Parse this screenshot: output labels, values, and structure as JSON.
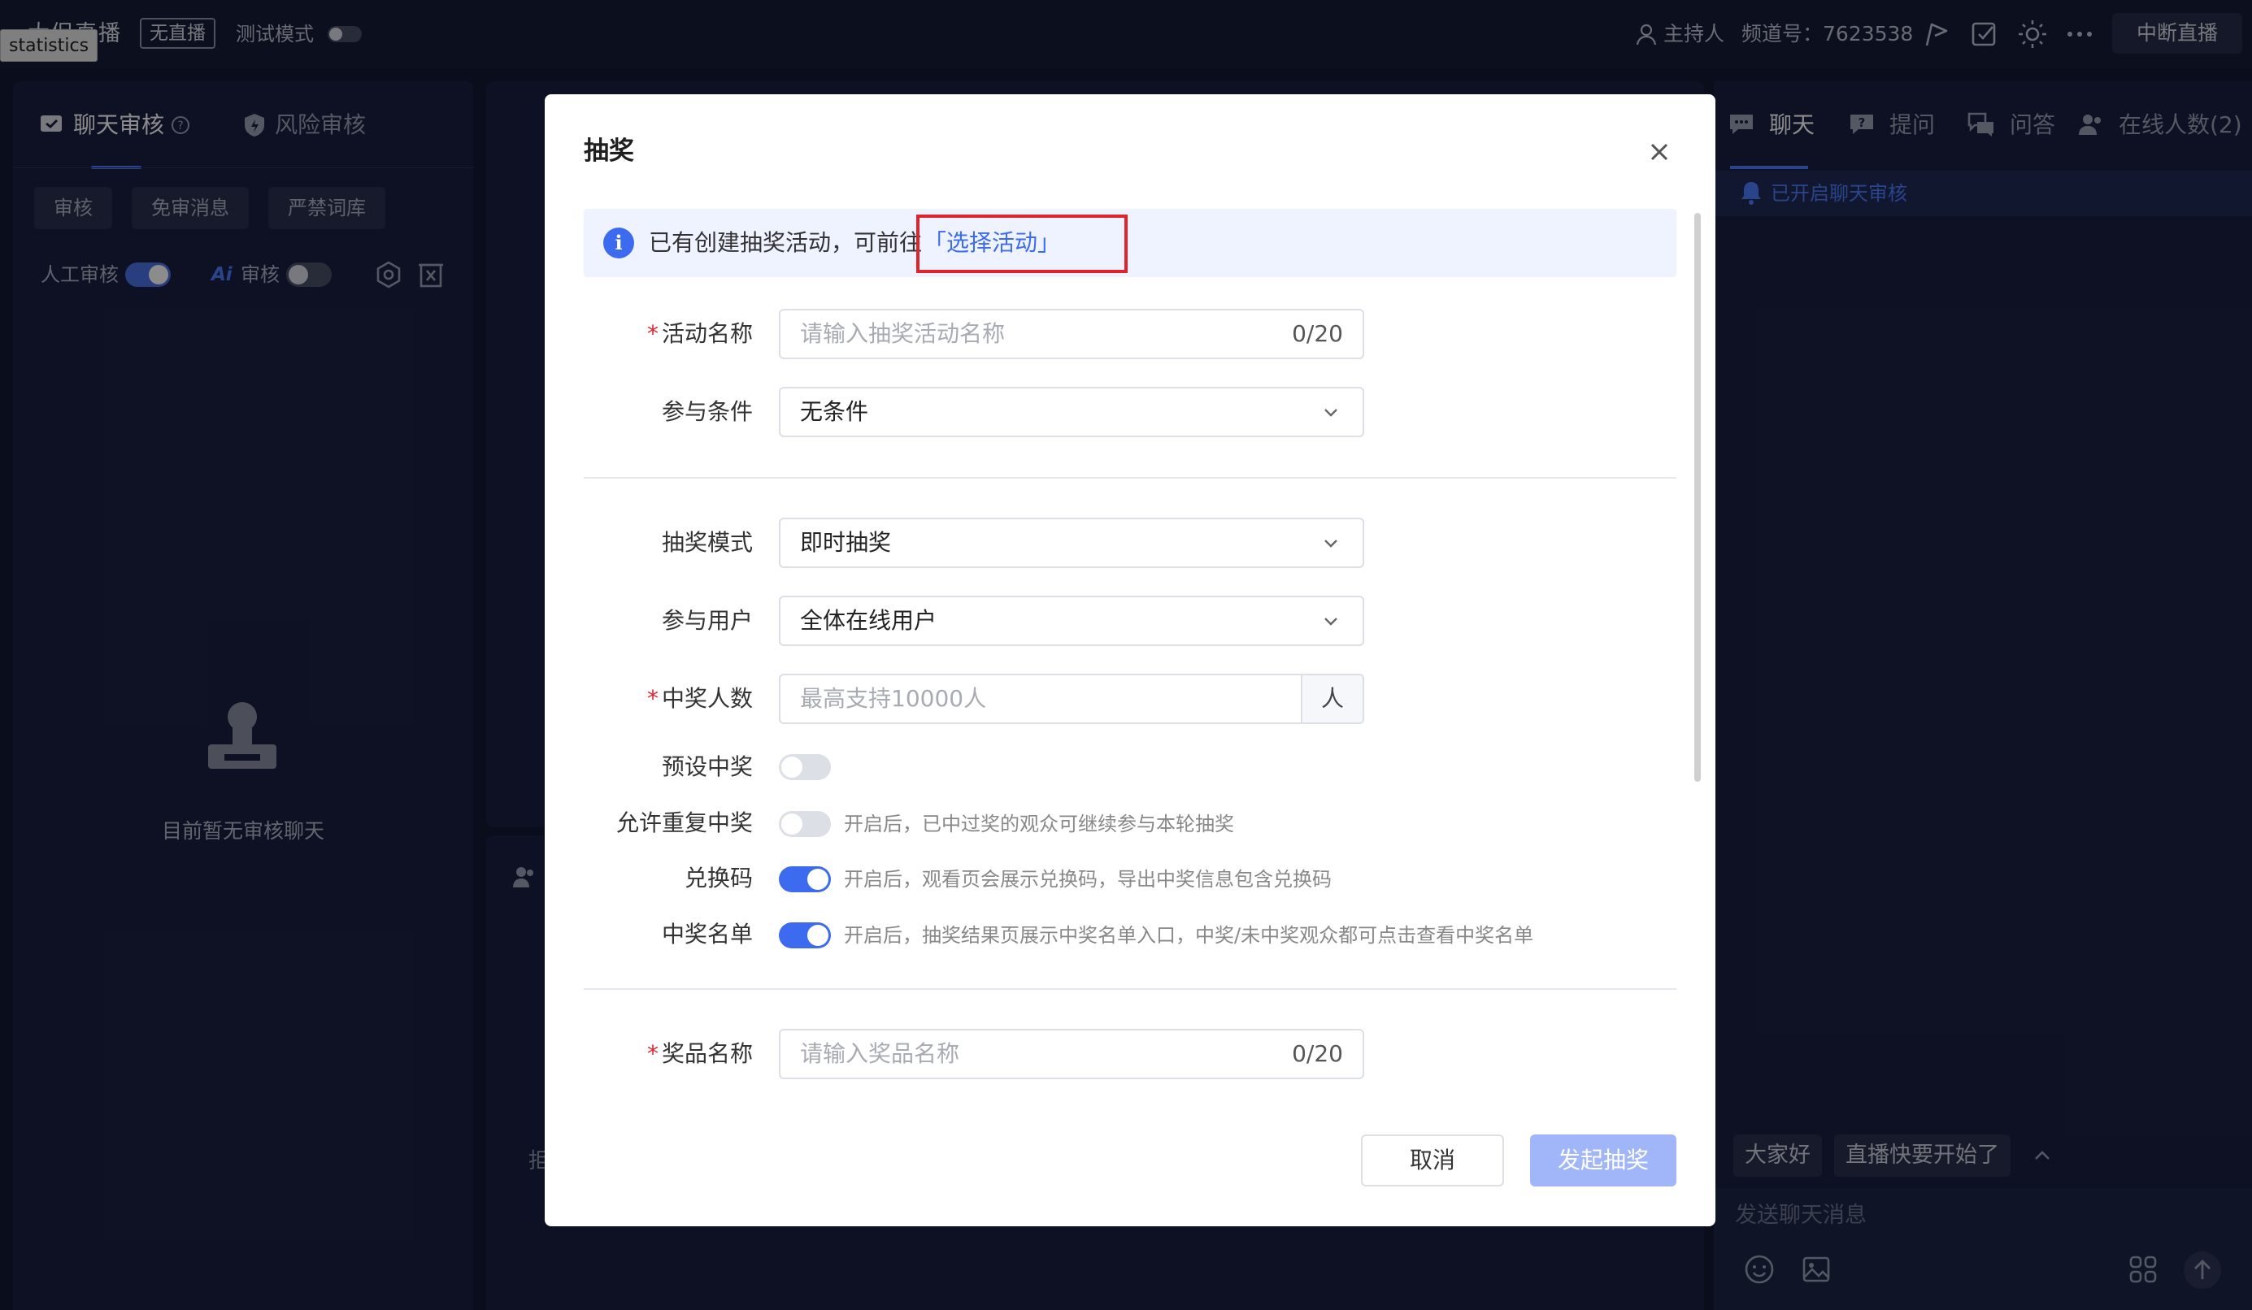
{
  "topbar": {
    "tooltip": "statistics",
    "live_title": "大促直播",
    "status_badge": "无直播",
    "test_mode_label": "测试模式",
    "host_label": "主持人",
    "channel_label": "频道号：7623538",
    "end_live_label": "中断直播"
  },
  "left_panel": {
    "tabs": [
      {
        "label": "聊天审核",
        "active": true
      },
      {
        "label": "风险审核",
        "active": false
      }
    ],
    "chips": [
      "审核",
      "免审消息",
      "严禁词库"
    ],
    "manual_review_label": "人工审核",
    "ai_badge": "Ai",
    "ai_review_label": "审核",
    "empty_text": "目前暂无审核聊天"
  },
  "middle_panel": {
    "fragment_text": "拒"
  },
  "right_panel": {
    "tabs": [
      {
        "label": "聊天",
        "active": true
      },
      {
        "label": "提问",
        "active": false
      },
      {
        "label": "问答",
        "active": false
      },
      {
        "label": "在线人数(2)",
        "active": false
      }
    ],
    "notice": "已开启聊天审核",
    "quick_replies": [
      "大家好",
      "直播快要开始了"
    ],
    "input_placeholder": "发送聊天消息"
  },
  "modal": {
    "title": "抽奖",
    "alert_text": "已有创建抽奖活动，可前往",
    "alert_link": "「选择活动」",
    "fields": {
      "activity_name": {
        "label": "活动名称",
        "required": true,
        "placeholder": "请输入抽奖活动名称",
        "count": "0/20"
      },
      "condition": {
        "label": "参与条件",
        "value": "无条件"
      },
      "mode": {
        "label": "抽奖模式",
        "value": "即时抽奖"
      },
      "users": {
        "label": "参与用户",
        "value": "全体在线用户"
      },
      "winners": {
        "label": "中奖人数",
        "required": true,
        "placeholder": "最高支持10000人",
        "suffix": "人"
      },
      "preset": {
        "label": "预设中奖",
        "on": false
      },
      "repeat": {
        "label": "允许重复中奖",
        "on": false,
        "hint": "开启后，已中过奖的观众可继续参与本轮抽奖"
      },
      "code": {
        "label": "兑换码",
        "on": true,
        "hint": "开启后，观看页会展示兑换码，导出中奖信息包含兑换码"
      },
      "winner_list": {
        "label": "中奖名单",
        "on": true,
        "hint": "开启后，抽奖结果页展示中奖名单入口，中奖/未中奖观众都可点击查看中奖名单"
      },
      "prize_name": {
        "label": "奖品名称",
        "required": true,
        "placeholder": "请输入奖品名称",
        "count": "0/20"
      }
    },
    "cancel_label": "取消",
    "submit_label": "发起抽奖"
  },
  "colors": {
    "primary": "#3d6bf0",
    "primary_disabled": "#a0b6f8",
    "required": "#e0242e",
    "highlight_box": "#e0242e",
    "dark_bg": "#131a33"
  }
}
